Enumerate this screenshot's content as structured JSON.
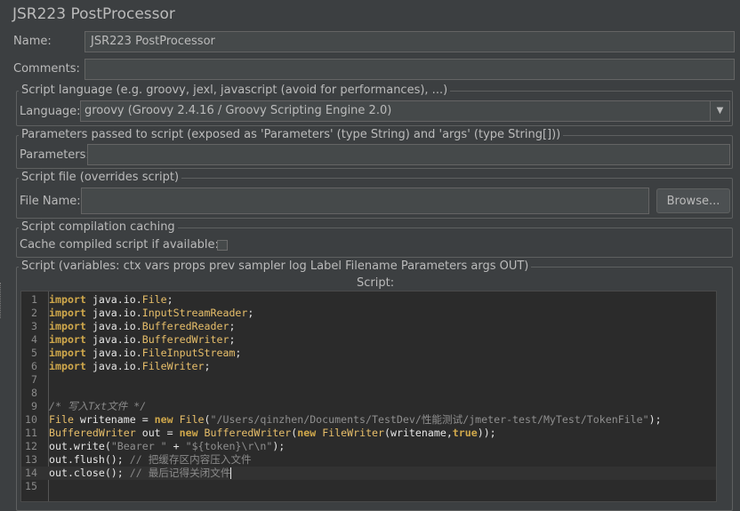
{
  "title": "JSR223 PostProcessor",
  "name_label": "Name:",
  "name_value": "JSR223 PostProcessor",
  "comments_label": "Comments:",
  "comments_value": "",
  "script_language": {
    "legend": "Script language (e.g. groovy, jexl, javascript (avoid for performances), ...)",
    "label": "Language:",
    "value": "groovy     (Groovy 2.4.16 / Groovy Scripting Engine 2.0)"
  },
  "parameters": {
    "legend": "Parameters passed to script (exposed as 'Parameters' (type String) and 'args' (type String[]))",
    "label": "Parameters:",
    "value": ""
  },
  "script_file": {
    "legend": "Script file (overrides script)",
    "label": "File Name:",
    "value": "",
    "browse_label": "Browse..."
  },
  "caching": {
    "legend": "Script compilation caching",
    "label": "Cache compiled script if available:",
    "checked": false
  },
  "script": {
    "legend": "Script (variables: ctx vars props prev sampler log Label Filename Parameters args OUT)",
    "header": "Script:",
    "current_line": 14,
    "lines": [
      {
        "n": "1",
        "tokens": [
          {
            "t": "import",
            "c": "kw"
          },
          {
            "t": " java.io.",
            "c": ""
          },
          {
            "t": "File",
            "c": "tp"
          },
          {
            "t": ";",
            "c": ""
          }
        ]
      },
      {
        "n": "2",
        "tokens": [
          {
            "t": "import",
            "c": "kw"
          },
          {
            "t": " java.io.",
            "c": ""
          },
          {
            "t": "InputStreamReader",
            "c": "tp"
          },
          {
            "t": ";",
            "c": ""
          }
        ]
      },
      {
        "n": "3",
        "tokens": [
          {
            "t": "import",
            "c": "kw"
          },
          {
            "t": " java.io.",
            "c": ""
          },
          {
            "t": "BufferedReader",
            "c": "tp"
          },
          {
            "t": ";",
            "c": ""
          }
        ]
      },
      {
        "n": "4",
        "tokens": [
          {
            "t": "import",
            "c": "kw"
          },
          {
            "t": " java.io.",
            "c": ""
          },
          {
            "t": "BufferedWriter",
            "c": "tp"
          },
          {
            "t": ";",
            "c": ""
          }
        ]
      },
      {
        "n": "5",
        "tokens": [
          {
            "t": "import",
            "c": "kw"
          },
          {
            "t": " java.io.",
            "c": ""
          },
          {
            "t": "FileInputStream",
            "c": "tp"
          },
          {
            "t": ";",
            "c": ""
          }
        ]
      },
      {
        "n": "6",
        "tokens": [
          {
            "t": "import",
            "c": "kw"
          },
          {
            "t": " java.io.",
            "c": ""
          },
          {
            "t": "FileWriter",
            "c": "tp"
          },
          {
            "t": ";",
            "c": ""
          }
        ]
      },
      {
        "n": "7",
        "tokens": []
      },
      {
        "n": "8",
        "tokens": []
      },
      {
        "n": "9",
        "tokens": [
          {
            "t": "/* 写入Txt文件 */",
            "c": "cmi"
          }
        ]
      },
      {
        "n": "10",
        "tokens": [
          {
            "t": "File",
            "c": "tp"
          },
          {
            "t": " writename = ",
            "c": ""
          },
          {
            "t": "new",
            "c": "kw"
          },
          {
            "t": " ",
            "c": ""
          },
          {
            "t": "File",
            "c": "tp"
          },
          {
            "t": "(",
            "c": ""
          },
          {
            "t": "\"/Users/qinzhen/Documents/TestDev/性能测试/jmeter-test/MyTest/TokenFile\"",
            "c": "str"
          },
          {
            "t": ");",
            "c": ""
          }
        ]
      },
      {
        "n": "11",
        "tokens": [
          {
            "t": "BufferedWriter",
            "c": "tp"
          },
          {
            "t": " out = ",
            "c": ""
          },
          {
            "t": "new",
            "c": "kw"
          },
          {
            "t": " ",
            "c": ""
          },
          {
            "t": "BufferedWriter",
            "c": "tp"
          },
          {
            "t": "(",
            "c": ""
          },
          {
            "t": "new",
            "c": "kw"
          },
          {
            "t": " ",
            "c": ""
          },
          {
            "t": "FileWriter",
            "c": "tp"
          },
          {
            "t": "(writename,",
            "c": ""
          },
          {
            "t": "true",
            "c": "kw"
          },
          {
            "t": "));",
            "c": ""
          }
        ]
      },
      {
        "n": "12",
        "tokens": [
          {
            "t": "out.write(",
            "c": ""
          },
          {
            "t": "\"Bearer \"",
            "c": "str"
          },
          {
            "t": " + ",
            "c": ""
          },
          {
            "t": "\"${token}\\r\\n\"",
            "c": "str"
          },
          {
            "t": ");",
            "c": ""
          }
        ]
      },
      {
        "n": "13",
        "tokens": [
          {
            "t": "out.flush(); ",
            "c": ""
          },
          {
            "t": "// 把缓存区内容压入文件",
            "c": "cm"
          }
        ]
      },
      {
        "n": "14",
        "tokens": [
          {
            "t": "out.close(); ",
            "c": ""
          },
          {
            "t": "// 最后记得关闭文件",
            "c": "cm"
          }
        ]
      },
      {
        "n": "15",
        "tokens": []
      }
    ]
  }
}
